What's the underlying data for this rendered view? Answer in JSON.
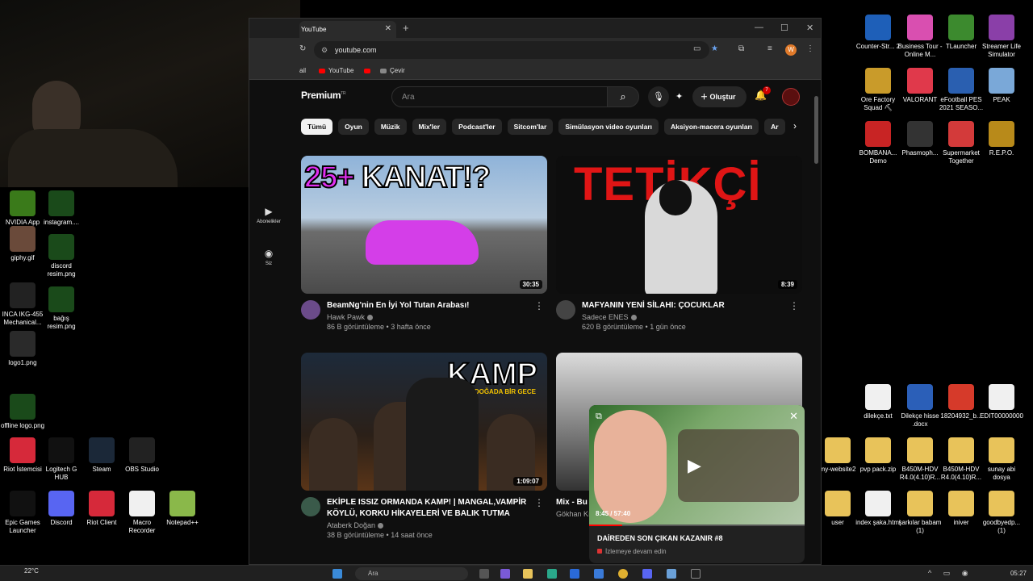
{
  "browser": {
    "tab_title": "YouTube",
    "tab_close": "✕",
    "new_tab": "+",
    "url": "youtube.com",
    "bookmarks": [
      "ail",
      "YouTube",
      "Çevir"
    ],
    "profile_initial": "W"
  },
  "youtube": {
    "logo": "Premium",
    "logo_region": "TR",
    "search_placeholder": "Ara",
    "create_label": "Oluştur",
    "notification_count": "7",
    "chips": [
      "Tümü",
      "Oyun",
      "Müzik",
      "Mix'ler",
      "Podcast'ler",
      "Sitcom'lar",
      "Simülasyon video oyunları",
      "Aksiyon-macera oyunları",
      "Ar"
    ],
    "rail": [
      {
        "label": "Abonelikler"
      },
      {
        "label": "Siz"
      }
    ],
    "videos": [
      {
        "thumb_text_a": "25+",
        "thumb_text_b": "KANAT!?",
        "duration": "30:35",
        "title": "BeamNg'nin En İyi Yol Tutan Arabası!",
        "channel": "Hawk Pawk",
        "stats": "86 B görüntüleme • 3 hafta önce",
        "avatar_color": "#6b4b8a"
      },
      {
        "thumb_text_a": "TETİKÇİ",
        "duration": "8:39",
        "title": "MAFYANIN YENİ SİLAHI: ÇOCUKLAR",
        "channel": "Sadece ENES",
        "stats": "620 B görüntüleme • 1 gün önce",
        "avatar_color": "#444444"
      },
      {
        "thumb_text_a": "KAMP",
        "thumb_text_b": "EKİPLE DOĞADA BİR GECE",
        "duration": "1:09:07",
        "title": "EKİPLE ISSIZ ORMANDA KAMP! | MANGAL,VAMPİR KÖYLÜ, KORKU HİKAYELERİ VE BALIK TUTMA",
        "channel": "Ataberk Doğan",
        "stats": "38 B görüntüleme • 14 saat önce",
        "avatar_color": "#3a5a4a"
      },
      {
        "title": "Mix - Bu Ş",
        "channel": "Gökhan Kı"
      }
    ],
    "miniplayer": {
      "time": "8:45 / 57:40",
      "progress": 0.152,
      "title": "DAİREDEN SON ÇIKAN KAZANIR #8",
      "subtitle": "İzlemeye devam edin"
    }
  },
  "desktop": {
    "right_icons": [
      {
        "label": "Counter-Str... 2",
        "color": "#1e5fb8"
      },
      {
        "label": "Business Tour - Online M...",
        "color": "#d94fb0"
      },
      {
        "label": "TLauncher",
        "color": "#3c8a2e"
      },
      {
        "label": "Streamer Life Simulator",
        "color": "#8a3fa8"
      },
      {
        "label": "Ore Factory Squad ⛏",
        "color": "#c99b2a"
      },
      {
        "label": "VALORANT",
        "color": "#e0394b"
      },
      {
        "label": "eFootball PES 2021 SEASO...",
        "color": "#2a5fb0"
      },
      {
        "label": "PEAK",
        "color": "#7aa8d8"
      },
      {
        "label": "BOMBANA... Demo",
        "color": "#c82424"
      },
      {
        "label": "Phasmoph...",
        "color": "#333333"
      },
      {
        "label": "Supermarket Together",
        "color": "#d33a3a"
      },
      {
        "label": "R.E.P.O.",
        "color": "#b88a1a"
      },
      {
        "label": "dilekçe.txt",
        "color": "#f0f0f0"
      },
      {
        "label": "Dilekçe hisse .docx",
        "color": "#2b5fb8"
      },
      {
        "label": "18204932_b...",
        "color": "#d63a2a"
      },
      {
        "label": "EDIT00000000",
        "color": "#f0f0f0"
      },
      {
        "label": "my-website2",
        "color": "#e8c35a"
      },
      {
        "label": "pvp pack.zip",
        "color": "#e8c35a"
      },
      {
        "label": "B450M-HDV R4.0(4.10)R...",
        "color": "#e8c35a"
      },
      {
        "label": "B450M-HDV R4.0(4.10)R...",
        "color": "#e8c35a"
      },
      {
        "label": "sunay abi dosya",
        "color": "#e8c35a"
      },
      {
        "label": "user",
        "color": "#e8c35a"
      },
      {
        "label": "index şaka.html",
        "color": "#f0f0f0"
      },
      {
        "label": "şarkılar babam (1)",
        "color": "#e8c35a"
      },
      {
        "label": "iniver",
        "color": "#e8c35a"
      },
      {
        "label": "goodbyedp... (1)",
        "color": "#e8c35a"
      }
    ],
    "left_icons": [
      {
        "label": "NVIDIA App",
        "color": "#3a7a1a"
      },
      {
        "label": "instagram....",
        "color": "#1a4a1a"
      },
      {
        "label": "giphy.gif",
        "color": "#6a4a3a"
      },
      {
        "label": "discord resim.png",
        "color": "#1a4a1a"
      },
      {
        "label": "INCA IKG-455 Mechanical...",
        "color": "#222222"
      },
      {
        "label": "bağış resim.png",
        "color": "#1a4a1a"
      },
      {
        "label": "logo1.png",
        "color": "#2a2a2a"
      },
      {
        "label": "offline logo.png",
        "color": "#1a4a1a"
      },
      {
        "label": "Riot İstemcisi",
        "color": "#d6293a"
      },
      {
        "label": "Logitech G HUB",
        "color": "#111111"
      },
      {
        "label": "Steam",
        "color": "#1b2838"
      },
      {
        "label": "OBS Studio",
        "color": "#222222"
      },
      {
        "label": "Epic Games Launcher",
        "color": "#111111"
      },
      {
        "label": "Discord",
        "color": "#5865f2"
      },
      {
        "label": "Riot Client",
        "color": "#d6293a"
      },
      {
        "label": "Macro Recorder",
        "color": "#f0f0f0"
      },
      {
        "label": "Notepad++",
        "color": "#8ab84a"
      }
    ]
  },
  "taskbar": {
    "temperature": "22°C",
    "search_placeholder": "Ara",
    "clock": "05:27"
  }
}
